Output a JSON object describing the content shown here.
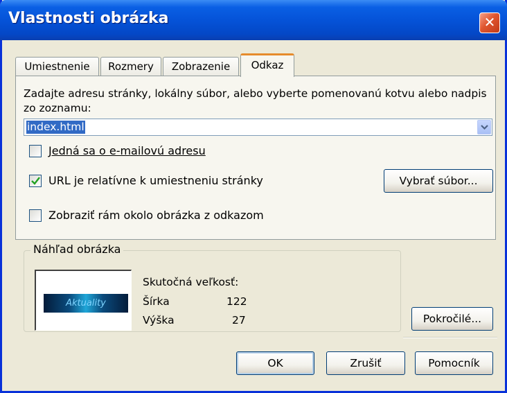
{
  "window": {
    "title": "Vlastnosti obrázka",
    "close_label": "✕"
  },
  "tabs": [
    {
      "label": "Umiestnenie",
      "active": false
    },
    {
      "label": "Rozmery",
      "active": false
    },
    {
      "label": "Zobrazenie",
      "active": false
    },
    {
      "label": "Odkaz",
      "active": true
    }
  ],
  "link": {
    "instruction": "Zadajte adresu stránky, lokálny súbor, alebo vyberte pomenovanú kotvu alebo nadpis zo zoznamu:",
    "url_value": "index.html",
    "email_label": "Jedná sa o e-mailovú adresu",
    "email_checked": false,
    "relative_label": "URL je relatívne k umiestneniu stránky",
    "relative_checked": true,
    "choose_file_button": "Vybrať súbor...",
    "show_border_label": "Zobraziť rám okolo obrázka z odkazom",
    "show_border_checked": false
  },
  "preview": {
    "group_label": "Náhľad obrázka",
    "image_text": "Aktuality",
    "actual_size_label": "Skutočná veľkosť:",
    "width_label": "Šírka",
    "width_value": "122",
    "height_label": "Výška",
    "height_value": "27"
  },
  "buttons": {
    "advanced": "Pokročilé...",
    "ok": "OK",
    "cancel": "Zrušiť",
    "help": "Pomocník"
  },
  "colors": {
    "titlebar": "#0553d8",
    "dialog_bg": "#ece9d8",
    "selection": "#316ac5",
    "active_tab_accent": "#e68b2c",
    "checkmark": "#21a121"
  }
}
